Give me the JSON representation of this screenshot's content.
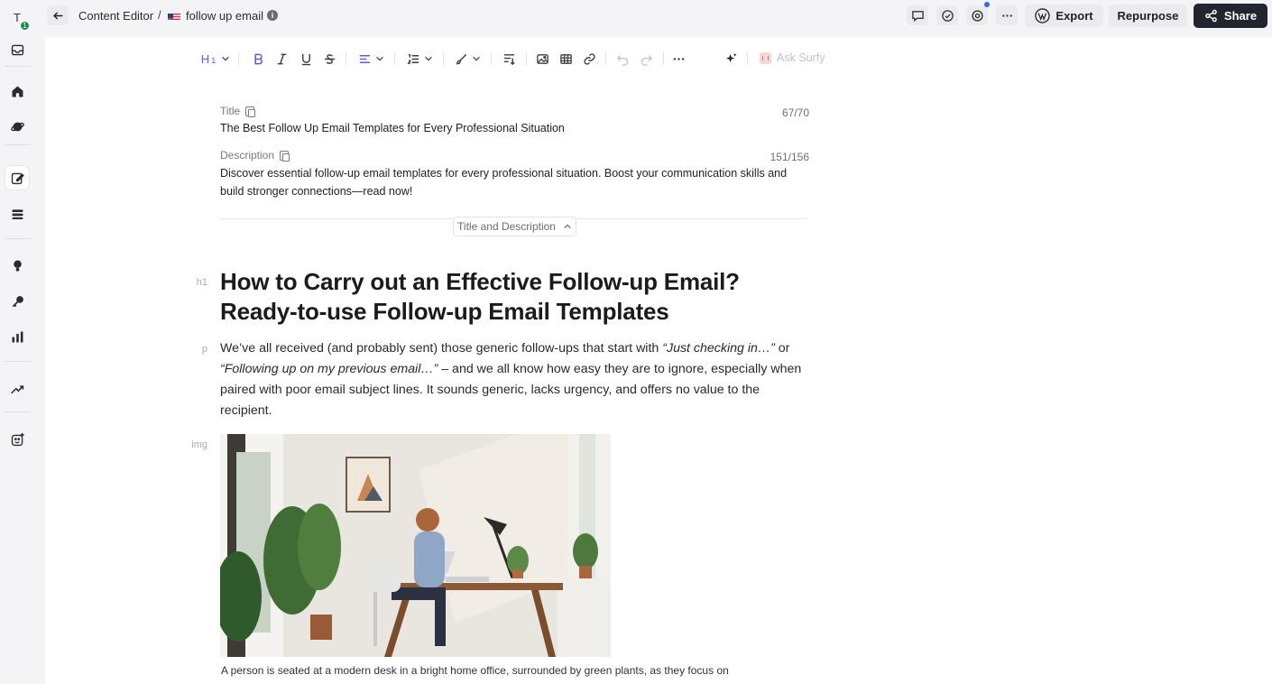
{
  "sidebar": {
    "avatar_letter": "T",
    "avatar_badge": "1",
    "icons": [
      "inbox-icon",
      "home-icon",
      "planet-icon",
      "edit-document-icon",
      "layers-icon",
      "lightbulb-icon",
      "key-icon",
      "bar-chart-icon",
      "trending-icon",
      "smile-plus-icon"
    ]
  },
  "header": {
    "breadcrumb_root": "Content Editor",
    "breadcrumb_sep": "/",
    "document_name": "follow up email",
    "info": "i",
    "export_label": "Export",
    "repurpose_label": "Repurpose",
    "share_label": "Share"
  },
  "toolbar": {
    "heading_label": "H",
    "heading_sub": "1",
    "ask_label": "Ask Surfy"
  },
  "meta": {
    "title_label": "Title",
    "title_counter": "67/70",
    "title_value": "The Best Follow Up Email Templates for Every Professional Situation",
    "description_label": "Description",
    "description_counter": "151/156",
    "description_value": "Discover essential follow-up email templates for every professional situation. Boost your communication skills and build stronger connections—read now!",
    "collapse_label": "Title and Description"
  },
  "document": {
    "h1_tag": "h1",
    "h1_text": "How to Carry out an Effective Follow-up Email? Ready-to-use Follow-up Email Templates",
    "p_tag": "p",
    "p_part1": "We’ve all received (and probably sent) those generic follow-ups that start with ",
    "p_em1": "“Just checking in…”",
    "p_part2": " or ",
    "p_em2": "“Following up on my previous email…”",
    "p_part3": " – and we all know how easy they are to ignore, especially when paired with poor email subject lines. It sounds generic, lacks urgency, and offers no value to the recipient.",
    "img_tag": "img",
    "caption": "A person is seated at a modern desk in a bright home office, surrounded by green plants, as they focus on writ"
  },
  "colors": {
    "accent_purple": "#6e55d6",
    "share_bg": "#23252e",
    "badge_green": "#1e8a4f",
    "notification_blue": "#2f6fe4"
  }
}
